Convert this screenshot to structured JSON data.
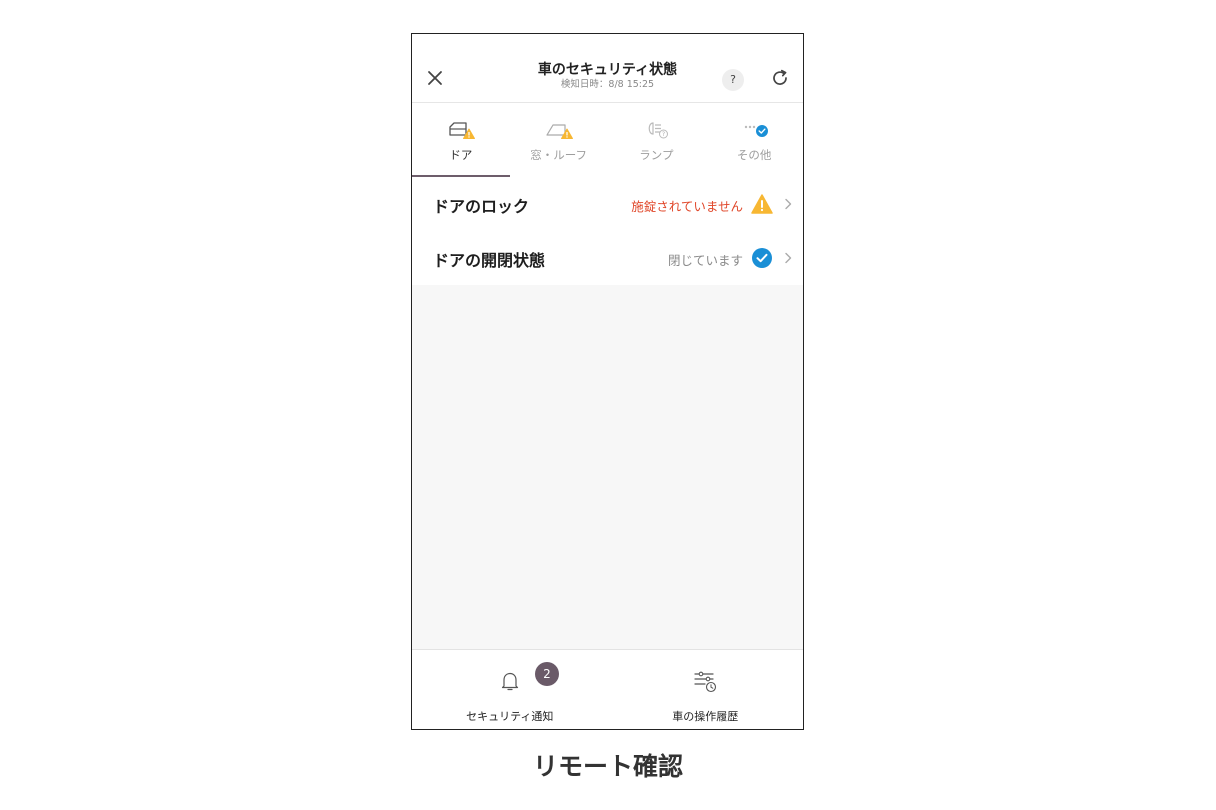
{
  "header": {
    "title": "車のセキュリティ状態",
    "subtitle": "検知日時：8/8 15:25",
    "help_label": "?"
  },
  "tabs": [
    {
      "label": "ドア",
      "icon": "door-icon",
      "status": "warning",
      "active": true
    },
    {
      "label": "窓・ルーフ",
      "icon": "window-icon",
      "status": "warning",
      "active": false
    },
    {
      "label": "ランプ",
      "icon": "lamp-icon",
      "status": "unknown",
      "active": false
    },
    {
      "label": "その他",
      "icon": "more-icon",
      "status": "ok",
      "active": false
    }
  ],
  "rows": [
    {
      "label": "ドアのロック",
      "status": "施錠されていません",
      "status_type": "warning"
    },
    {
      "label": "ドアの開閉状態",
      "status": "閉じています",
      "status_type": "ok"
    }
  ],
  "bottom_nav": [
    {
      "label": "セキュリティ通知",
      "icon": "bell-icon",
      "badge": "2"
    },
    {
      "label": "車の操作履歴",
      "icon": "history-sliders-icon"
    }
  ],
  "caption": "リモート確認",
  "colors": {
    "warning_text": "#e0472a",
    "warning_icon": "#f7b733",
    "ok_icon": "#1a8fd6",
    "accent": "#6d5d6b"
  }
}
